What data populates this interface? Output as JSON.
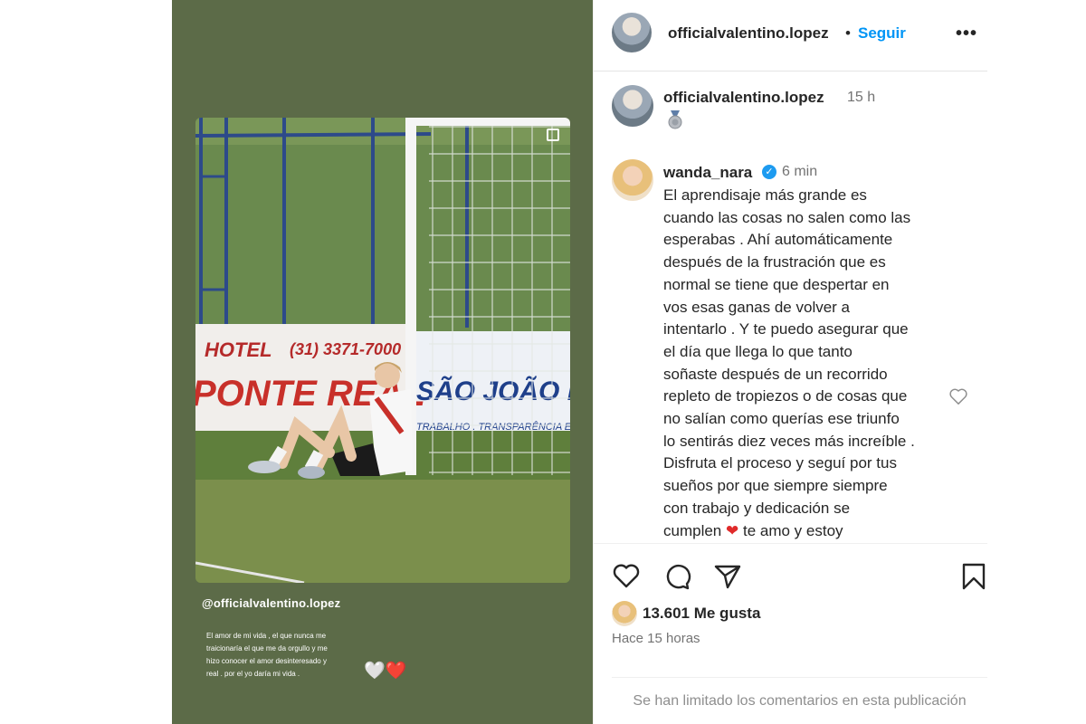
{
  "story": {
    "mention": "@officialvalentino.lopez",
    "caption": "El amor de mi vida , el que nunca me traicionaría el que me da orgullo y me hizo conocer el amor desinteresado y real . por el yo daría mi vida .",
    "photo_banners": {
      "hotel": "HOTEL",
      "phone": "(31) 3371-7000",
      "hotel_name": "PONTE REAL",
      "sponsor": "SÃO JOÃO D",
      "sponsor_sub": "TRABALHO . TRANSPARÊNCIA E TR"
    },
    "hearts": {
      "white": "🤍",
      "red": "❤️"
    }
  },
  "post": {
    "header": {
      "username": "officialvalentino.lopez",
      "separator": "•",
      "follow_label": "Seguir",
      "more_label": "•••"
    },
    "caption": {
      "username": "officialvalentino.lopez",
      "time": "15 h",
      "icon": "medal-icon"
    },
    "comment": {
      "username": "wanda_nara",
      "verified": true,
      "time": "6 min",
      "text": "El aprendisaje más grande es\ncuando las cosas no salen como las\nesperabas . Ahí automáticamente\ndespués de la frustración que es\nnormal se tiene que despertar en\nvos esas ganas de volver a\nintentarlo . Y te puedo asegurar que\nel día que llega lo que tanto\nsoñaste después de un recorrido\nrepleto de tropiezos o de cosas que\nno salían como querías ese triunfo\nlo sentirás diez veces más increíble .\nDisfruta el proceso y seguí por tus\nsueños por que siempre siempre\ncon trabajo y dedicación se\ncumplen",
      "heart": "❤",
      "text_end": " te amo y estoy"
    },
    "actions": [
      "heart-icon",
      "comment-icon",
      "share-icon",
      "bookmark-icon"
    ],
    "likes": "13.601 Me gusta",
    "time_ago": "Hace 15 horas",
    "comments_limited": "Se han limitado los comentarios en esta publicación"
  },
  "colors": {
    "story_bg": "#5c6b48",
    "follow": "#0095f6",
    "verified": "#1d9bf0",
    "heart_red": "#e02a2a"
  }
}
